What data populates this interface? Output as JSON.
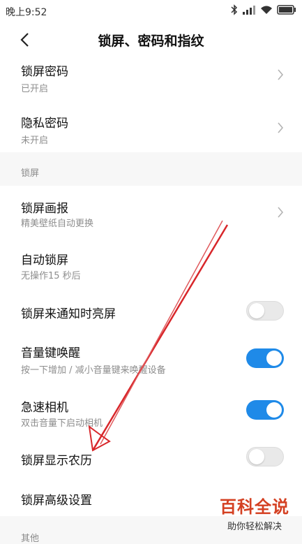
{
  "status_bar": {
    "time": "晚上9:52"
  },
  "header": {
    "title": "锁屏、密码和指纹"
  },
  "rows_top": [
    {
      "title": "锁屏密码",
      "subtitle": "已开启"
    },
    {
      "title": "隐私密码",
      "subtitle": "未开启"
    }
  ],
  "section_lockscreen": {
    "label": "锁屏"
  },
  "lock_rows": {
    "wallpaper": {
      "title": "锁屏画报",
      "subtitle": "精美壁纸自动更换"
    },
    "autolock": {
      "title": "自动锁屏",
      "subtitle": "无操作15 秒后"
    },
    "notify_wake": {
      "title": "锁屏来通知时亮屏",
      "enabled": false
    },
    "volume_wake": {
      "title": "音量键唤醒",
      "subtitle": "按一下增加 / 减小音量键来唤醒设备",
      "enabled": true
    },
    "quick_camera": {
      "title": "急速相机",
      "subtitle": "双击音量下启动相机",
      "enabled": true
    },
    "lunar": {
      "title": "锁屏显示农历",
      "enabled": false
    },
    "advanced": {
      "title": "锁屏高级设置"
    }
  },
  "section_other": {
    "label": "其他"
  },
  "watermark": {
    "brand": "百科全说",
    "slogan": "助你轻松解决"
  },
  "colors": {
    "accent": "#1f8ae8",
    "arrow": "#d8262a",
    "watermark": "#d44022"
  }
}
